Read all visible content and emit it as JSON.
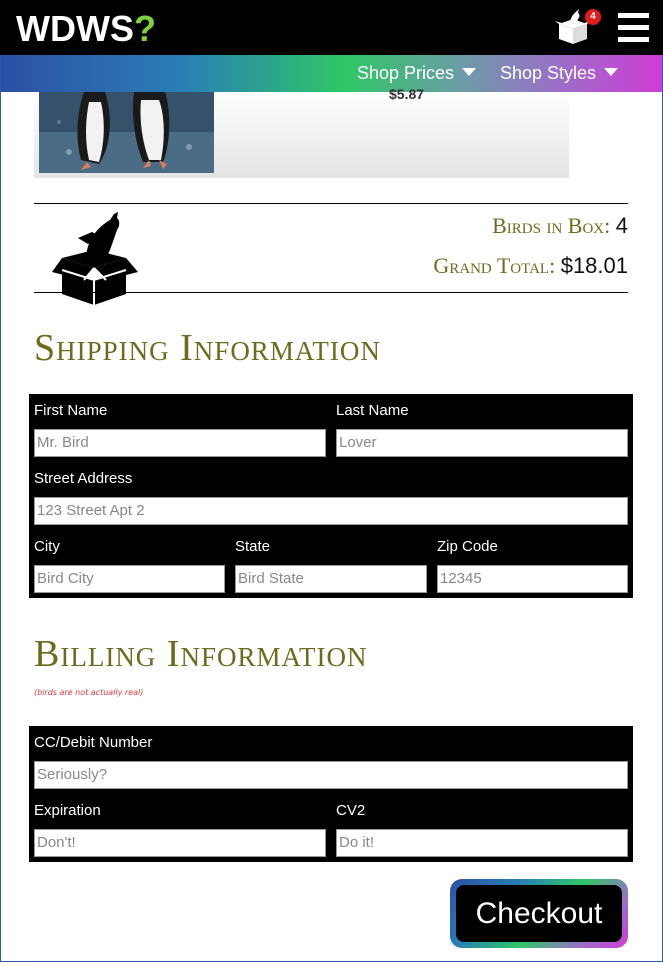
{
  "header": {
    "logo_text": "WDWS",
    "logo_mark": "?",
    "cart_icon": "bird-box-cart-icon",
    "cart_count": "4",
    "menu_icon": "hamburger-menu-icon"
  },
  "nav": {
    "items": [
      {
        "label": "Shop Prices"
      },
      {
        "label": "Shop Styles"
      }
    ]
  },
  "product": {
    "price": "$5.87"
  },
  "summary": {
    "birds_label": "Birds in Box:",
    "birds_count": "4",
    "total_label": "Grand Total:",
    "total_value": "$18.01"
  },
  "shipping": {
    "title": "Shipping Information",
    "first_name_label": "First Name",
    "first_name_placeholder": "Mr. Bird",
    "last_name_label": "Last Name",
    "last_name_placeholder": "Lover",
    "street_label": "Street Address",
    "street_placeholder": "123 Street Apt 2",
    "city_label": "City",
    "city_placeholder": "Bird City",
    "state_label": "State",
    "state_placeholder": "Bird State",
    "zip_label": "Zip Code",
    "zip_placeholder": "12345"
  },
  "billing": {
    "title": "Billing Information",
    "disclaimer": "(birds are not actually real)",
    "cc_label": "CC/Debit Number",
    "cc_placeholder": "Seriously?",
    "exp_label": "Expiration",
    "exp_placeholder": "Don't!",
    "cv2_label": "CV2",
    "cv2_placeholder": "Do it!"
  },
  "checkout": {
    "label": "Checkout"
  },
  "colors": {
    "accent_olive": "#6e6b1f",
    "logo_green": "#7fd13b",
    "badge_red": "#e31b1b"
  }
}
